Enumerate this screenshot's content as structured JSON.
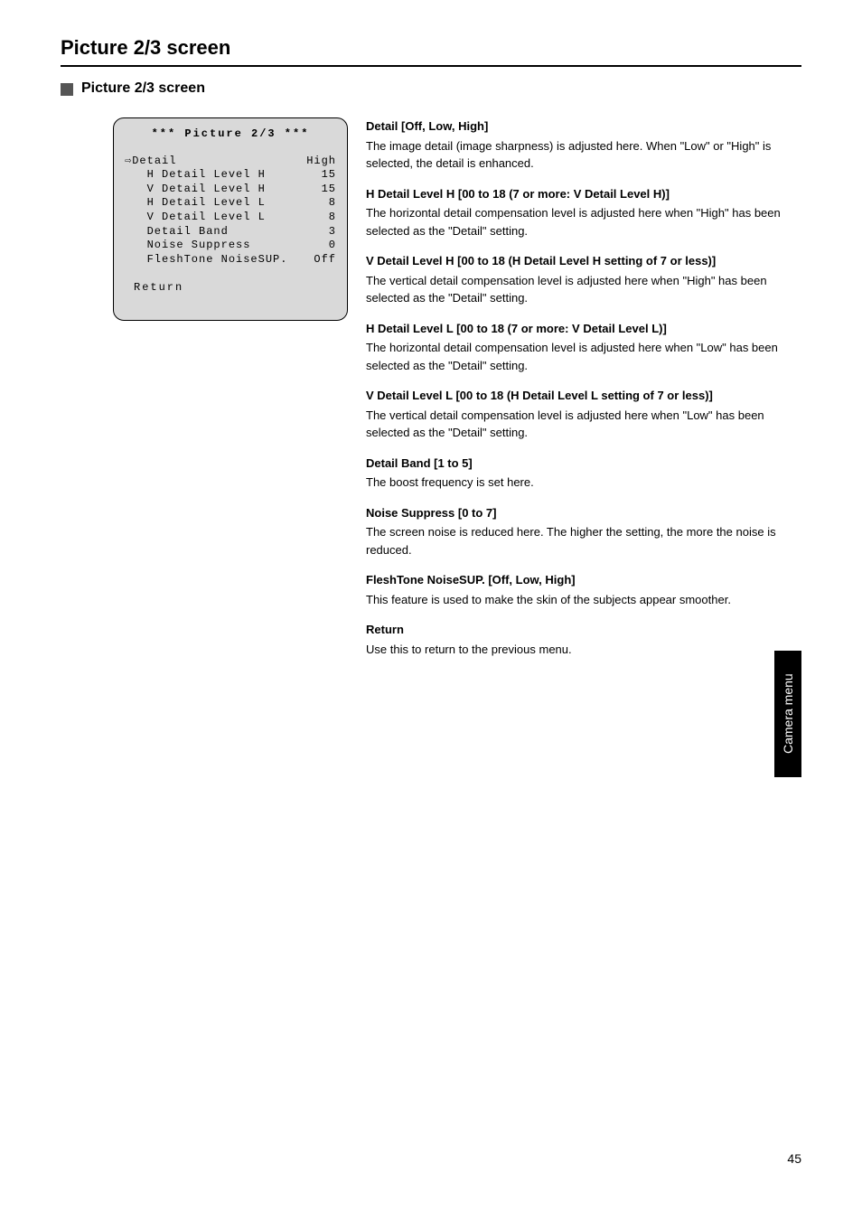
{
  "page": {
    "title": "Picture 2/3 screen",
    "sectionHeading": "Picture 2/3 screen",
    "number": "45"
  },
  "menu": {
    "title": "*** Picture 2/3 ***",
    "cursor": "⇨",
    "rows": [
      {
        "label": "Detail",
        "value": "High",
        "indent": 0,
        "selected": true
      },
      {
        "label": "H Detail Level H",
        "value": "15",
        "indent": 1
      },
      {
        "label": "V Detail Level H",
        "value": "15",
        "indent": 1
      },
      {
        "label": "H Detail Level L",
        "value": "8",
        "indent": 1
      },
      {
        "label": "V Detail Level L",
        "value": "8",
        "indent": 1
      },
      {
        "label": "Detail Band",
        "value": "3",
        "indent": 1
      },
      {
        "label": "Noise Suppress",
        "value": "0",
        "indent": 1
      },
      {
        "label": "FleshTone NoiseSUP.",
        "value": "Off",
        "indent": 1
      }
    ],
    "return": "Return"
  },
  "descriptions": [
    {
      "title": "Detail [Off, Low, High]",
      "text": "The image detail (image sharpness) is adjusted here. When \"Low\" or \"High\" is selected, the detail is enhanced."
    },
    {
      "title": "H Detail Level H [00 to 18 (7 or more: V Detail Level H)]",
      "text": "The horizontal detail compensation level is adjusted here when \"High\" has been selected as the \"Detail\" setting."
    },
    {
      "title": "V Detail Level H [00 to 18 (H Detail Level H setting of 7 or less)]",
      "text": "The vertical detail compensation level is adjusted here when \"High\" has been selected as the \"Detail\" setting."
    },
    {
      "title": "H Detail Level L [00 to 18 (7 or more: V Detail Level L)]",
      "text": "The horizontal detail compensation level is adjusted here when \"Low\" has been selected as the \"Detail\" setting."
    },
    {
      "title": "V Detail Level L [00 to 18 (H Detail Level L setting of 7 or less)]",
      "text": "The vertical detail compensation level is adjusted here when \"Low\" has been selected as the \"Detail\" setting."
    },
    {
      "title": "Detail Band [1 to 5]",
      "text": "The boost frequency is set here."
    },
    {
      "title": "Noise Suppress [0 to 7]",
      "text": "The screen noise is reduced here. The higher the setting, the more the noise is reduced."
    },
    {
      "title": "FleshTone NoiseSUP. [Off, Low, High]",
      "text": "This feature is used to make the skin of the subjects appear smoother."
    },
    {
      "title": "Return",
      "text": "Use this to return to the previous menu."
    }
  ],
  "sideTab": "Camera menu"
}
